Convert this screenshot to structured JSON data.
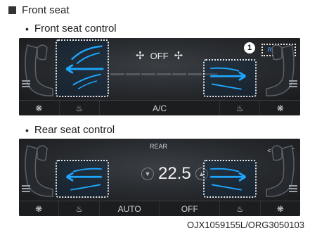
{
  "section": {
    "title": "Front seat"
  },
  "front_panel": {
    "subtitle": "Front seat control",
    "fan_status": "OFF",
    "rear_button": "REAR >",
    "callout": "1",
    "bottom_bar": {
      "ac_label": "A/C"
    }
  },
  "rear_panel": {
    "subtitle": "Rear seat control",
    "header": "REAR",
    "front_button": "< FRONT",
    "temperature": "22.5",
    "bottom_bar": {
      "auto_label": "AUTO",
      "off_label": "OFF"
    }
  },
  "caption": "OJX1059155L/ORG3050103",
  "colors": {
    "panel_bg": "#121314",
    "accent_blue": "#3aa0ff",
    "vent_blue": "#1ea7ff"
  },
  "icons": [
    "fan-icon",
    "heated-seat-icon",
    "ventilated-seat-icon",
    "heated-steering-icon",
    "menu-icon",
    "chevron-down-icon",
    "chevron-up-icon"
  ]
}
